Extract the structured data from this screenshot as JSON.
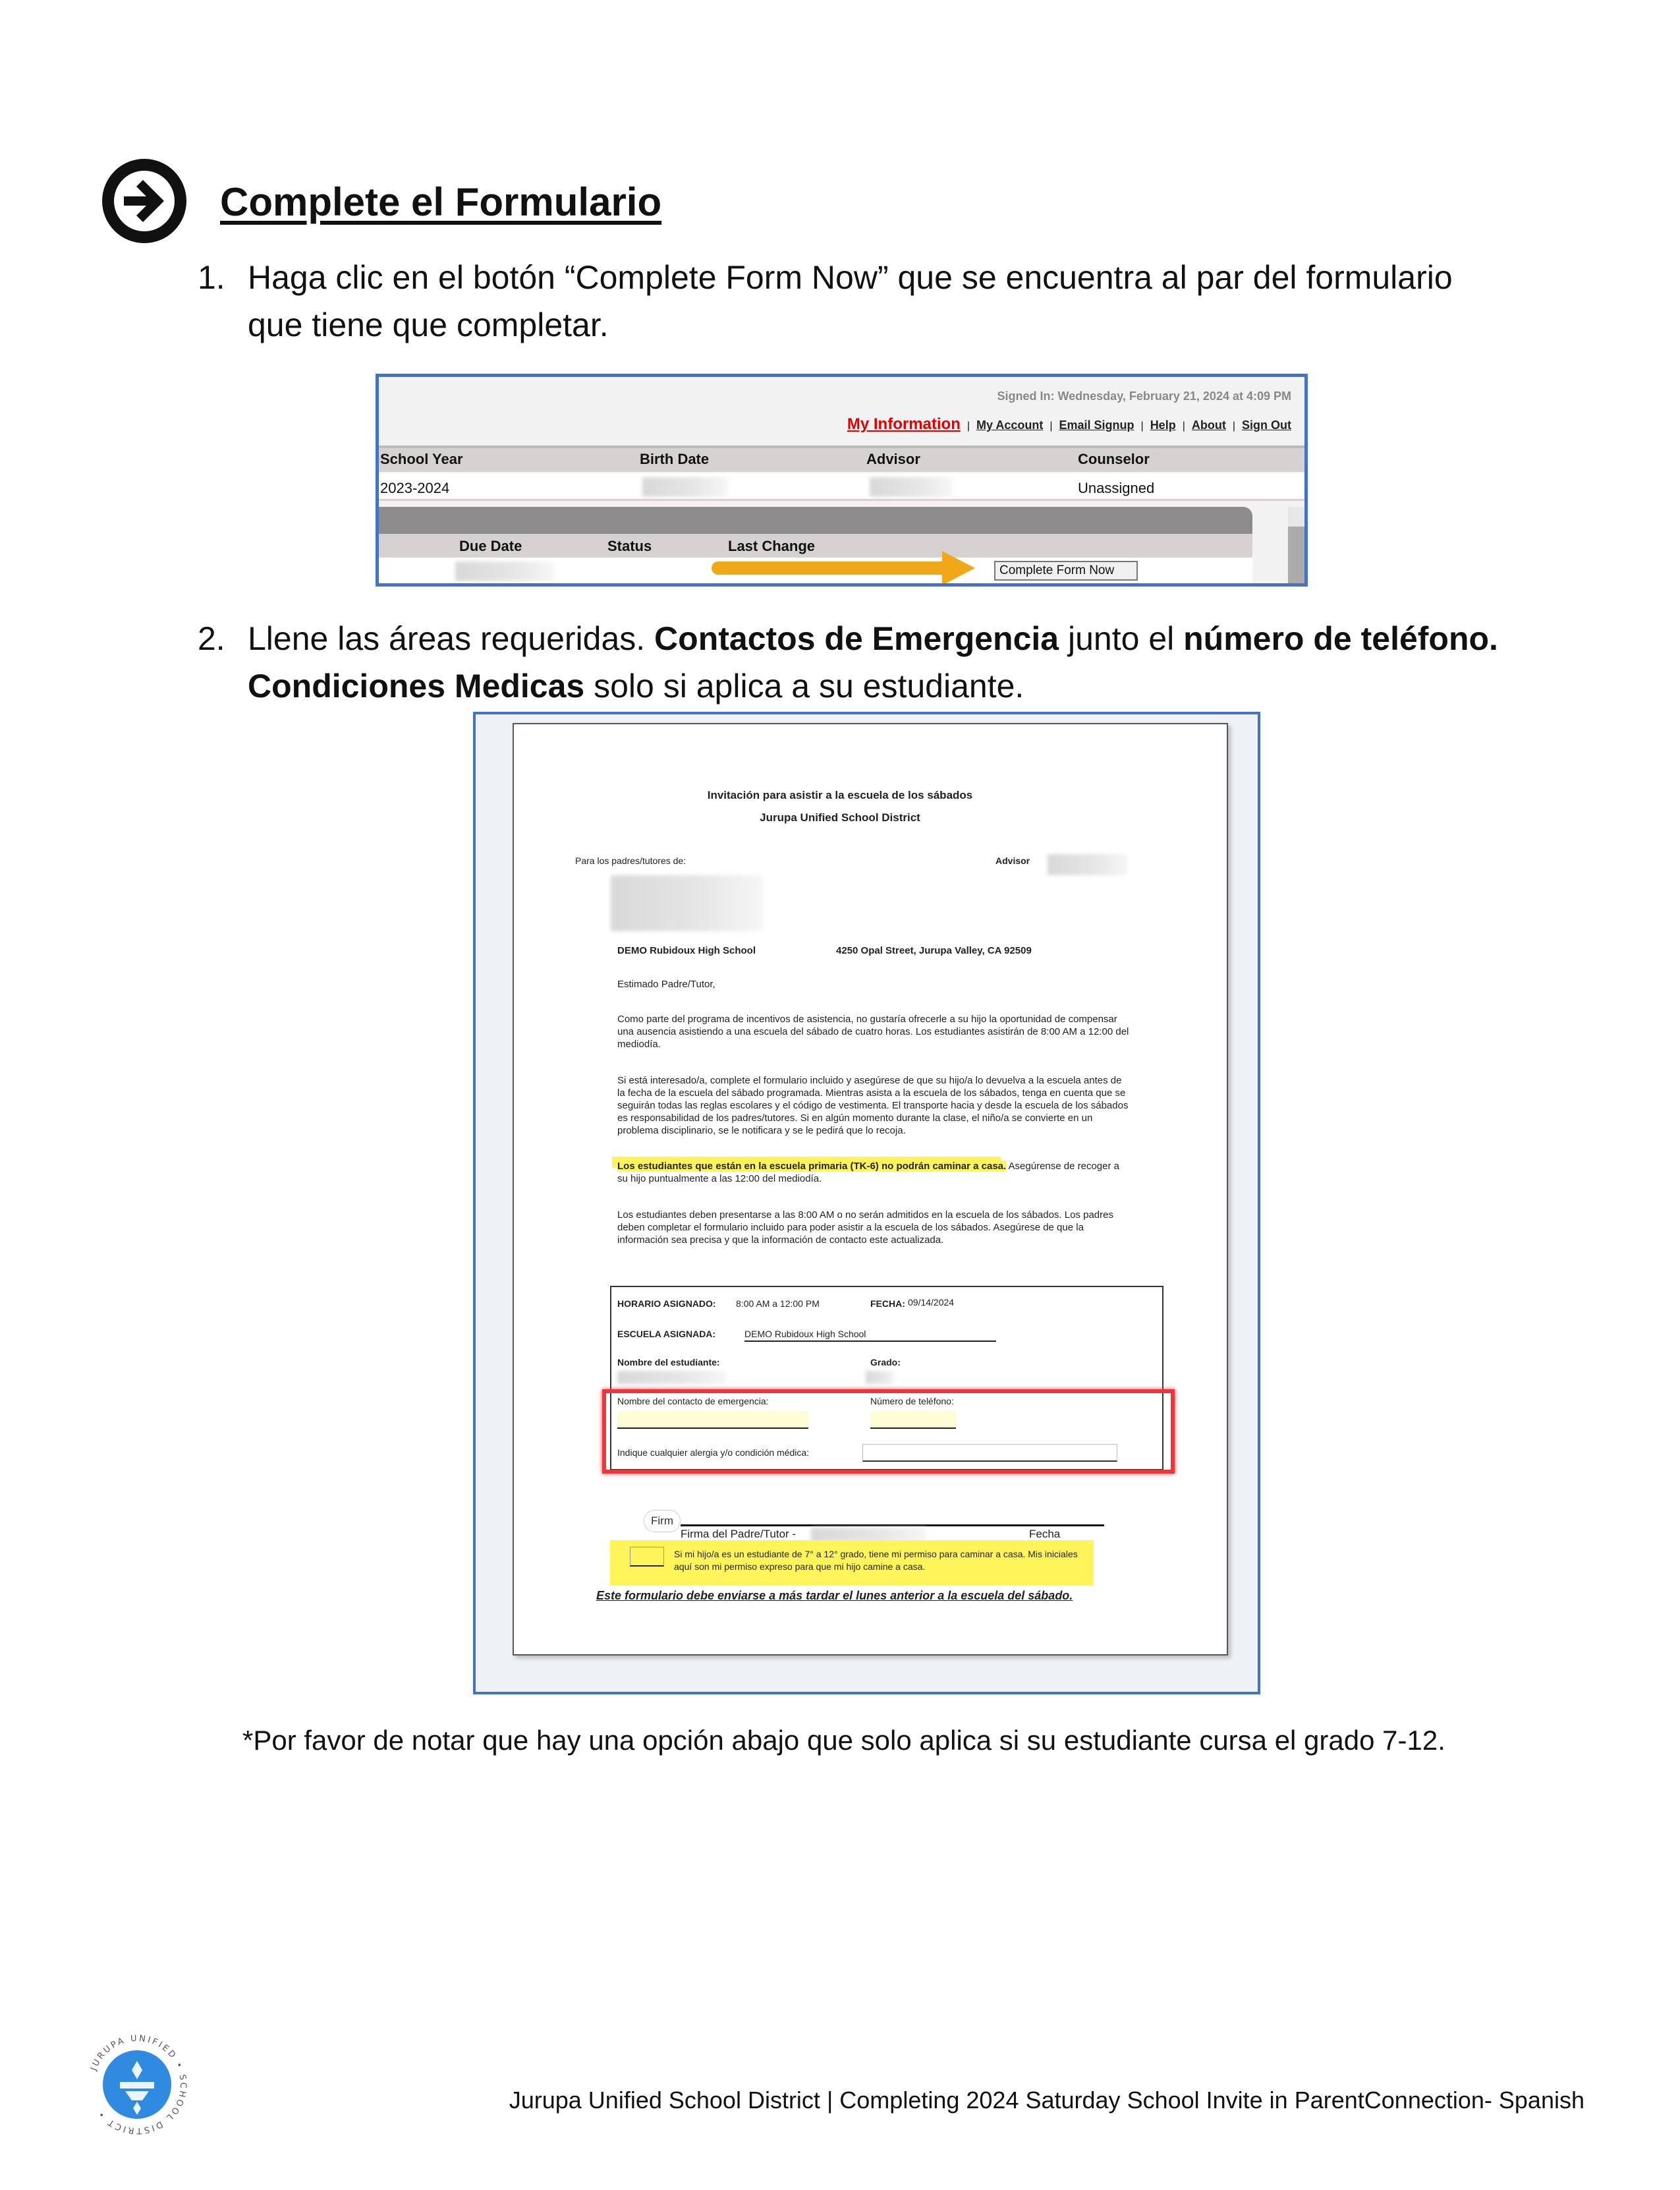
{
  "heading": {
    "title": "Complete el Formulario",
    "icon": "arrow-right-circle-icon"
  },
  "steps": [
    {
      "num": "1.",
      "line1": "Haga clic en el botón “Complete Form Now” que se encuentra al par del formulario",
      "line2": "que tiene que completar."
    },
    {
      "num": "2.",
      "parts": [
        "Llene las áreas requeridas. ",
        "Contactos de Emergencia",
        " junto el ",
        "número de teléfono."
      ],
      "line2": [
        "Condiciones Medicas",
        " solo si aplica a su estudiante."
      ]
    }
  ],
  "portal": {
    "signed_in": "Signed In: Wednesday, February 21, 2024 at 4:09 PM",
    "links": [
      "My Information",
      "My Account",
      "Email Signup",
      "Help",
      "About",
      "Sign Out"
    ],
    "columns": [
      "School Year",
      "Birth Date",
      "Advisor",
      "Counselor"
    ],
    "row": {
      "school_year": "2023-2024",
      "counselor": "Unassigned"
    },
    "form_columns": [
      "Due Date",
      "Status",
      "Last Change"
    ],
    "button": "Complete Form Now",
    "colors": {
      "active_link": "#e00000",
      "arrow": "#f0a818",
      "border": "#4472c4"
    }
  },
  "form": {
    "title": "Invitación para asistir a la escuela de los sábados",
    "district": "Jurupa Unified School District",
    "to_label": "Para los padres/tutores de:",
    "advisor_label": "Advisor",
    "school": "DEMO Rubidoux High School",
    "address": "4250 Opal Street, Jurupa Valley, CA 92509",
    "greeting": "Estimado Padre/Tutor,",
    "p1": "Como parte del programa de incentivos de asistencia, no gustaría ofrecerle a su hijo la oportunidad de compensar una ausencia asistiendo a una escuela del sábado de cuatro horas. Los estudiantes asistirán de 8:00 AM a 12:00 del mediodía.",
    "p2": "Si está interesado/a, complete el formulario incluido y asegúrese de que su hijo/a lo devuelva a la escuela antes de la fecha de la escuela del sábado programada. Mientras asista a la escuela de los sábados, tenga en cuenta que se seguirán todas las reglas escolares y el código de vestimenta. El transporte hacia y desde la escuela de los sábados es responsabilidad de los padres/tutores. Si en algún momento durante la clase, el niño/a se convierte en un problema disciplinario, se le notificara y se le pedirá que lo recoja.",
    "p3_highlight": "Los estudiantes que están en la escuela primaria (TK-6) no podrán caminar a casa.",
    "p3_rest": " Asegúrense de recoger a su hijo puntualmente a las 12:00 del mediodía.",
    "p4": "Los estudiantes deben presentarse a las 8:00 AM o no serán admitidos en la escuela de los sábados. Los padres deben completar el formulario incluido para poder asistir a la escuela de los sábados. Asegúrese de que la información sea precisa y que la información de contacto este actualizada.",
    "horario_label": "HORARIO ASIGNADO:",
    "horario": "8:00 AM a 12:00 PM",
    "fecha_label": "FECHA:",
    "fecha": "09/14/2024",
    "escuela_label": "ESCUELA ASIGNADA:",
    "escuela": "DEMO Rubidoux High School",
    "student_label": "Nombre del estudiante:",
    "grade_label": "Grado:",
    "contact_label": "Nombre del contacto de emergencia:",
    "phone_label": "Número de teléfono:",
    "medical_label": "Indique cualquier alergia y/o condición médica:",
    "sign_button": "Firm",
    "signature_label": "Firma del Padre/Tutor -",
    "date_label": "Fecha",
    "walk_permission": "Si mi hijo/a es un estudiante de 7° a 12° grado, tiene mi permiso para caminar a casa. Mis iniciales aquí son mi permiso expreso para que mi hijo camine a casa.",
    "deadline": "Este formulario debe enviarse a más tardar el lunes anterior a la escuela del sábado.",
    "colors": {
      "highlight": "#fff45a",
      "required_box": "#e8383d",
      "field_fill": "#fffdd6"
    }
  },
  "note": "*Por favor de notar que hay una opción abajo que solo aplica si su estudiante cursa el grado 7-12.",
  "footer": {
    "text": "Jurupa Unified School District | Completing 2024 Saturday School Invite in ParentConnection- Spanish",
    "logo_text": "JURUPA UNIFIED SCHOOL DISTRICT"
  }
}
